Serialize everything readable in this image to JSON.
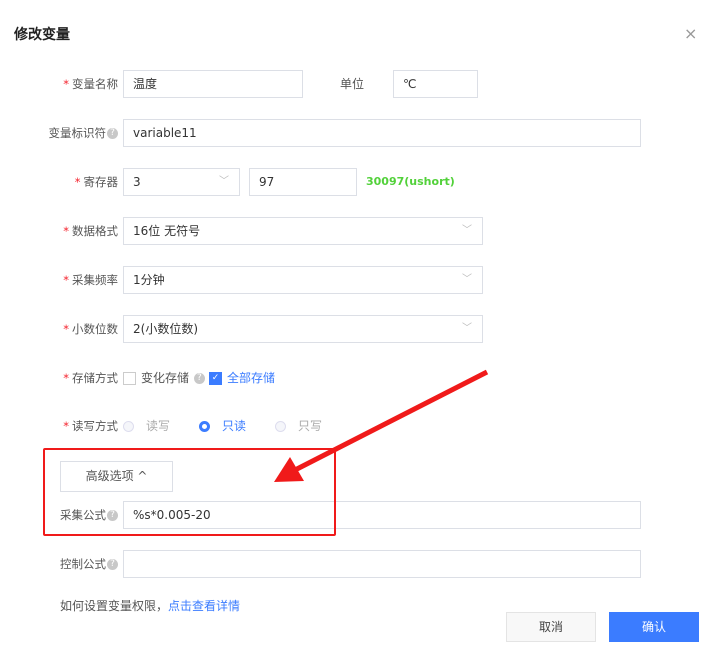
{
  "dialog": {
    "title": "修改变量",
    "close": "×"
  },
  "fields": {
    "name": {
      "label": "变量名称",
      "value": "温度"
    },
    "unit": {
      "label": "单位",
      "value": "℃"
    },
    "identifier": {
      "label": "变量标识符",
      "value": "variable11"
    },
    "register": {
      "label": "寄存器",
      "type_value": "3",
      "address_value": "97",
      "computed": "30097(ushort)"
    },
    "data_format": {
      "label": "数据格式",
      "value": "16位 无符号"
    },
    "sample_rate": {
      "label": "采集频率",
      "value": "1分钟"
    },
    "decimals": {
      "label": "小数位数",
      "value": "2(小数位数)"
    },
    "storage": {
      "label": "存储方式",
      "options": [
        {
          "label": "变化存储",
          "checked": false
        },
        {
          "label": "全部存储",
          "checked": true
        }
      ]
    },
    "rw": {
      "label": "读写方式",
      "options": [
        {
          "label": "读写",
          "selected": false,
          "disabled": true
        },
        {
          "label": "只读",
          "selected": true
        },
        {
          "label": "只写",
          "selected": false,
          "disabled": true
        }
      ]
    },
    "advanced": {
      "label": "高级选项 ^"
    },
    "collect_formula": {
      "label": "采集公式",
      "value": "%s*0.005-20"
    },
    "control_formula": {
      "label": "控制公式",
      "value": ""
    }
  },
  "help": {
    "text": "如何设置变量权限，",
    "link": "点击查看详情"
  },
  "footer": {
    "cancel": "取消",
    "confirm": "确认"
  },
  "colors": {
    "accent": "#3b7cff",
    "computed": "#52d13a",
    "annotation": "#f01a1a"
  }
}
